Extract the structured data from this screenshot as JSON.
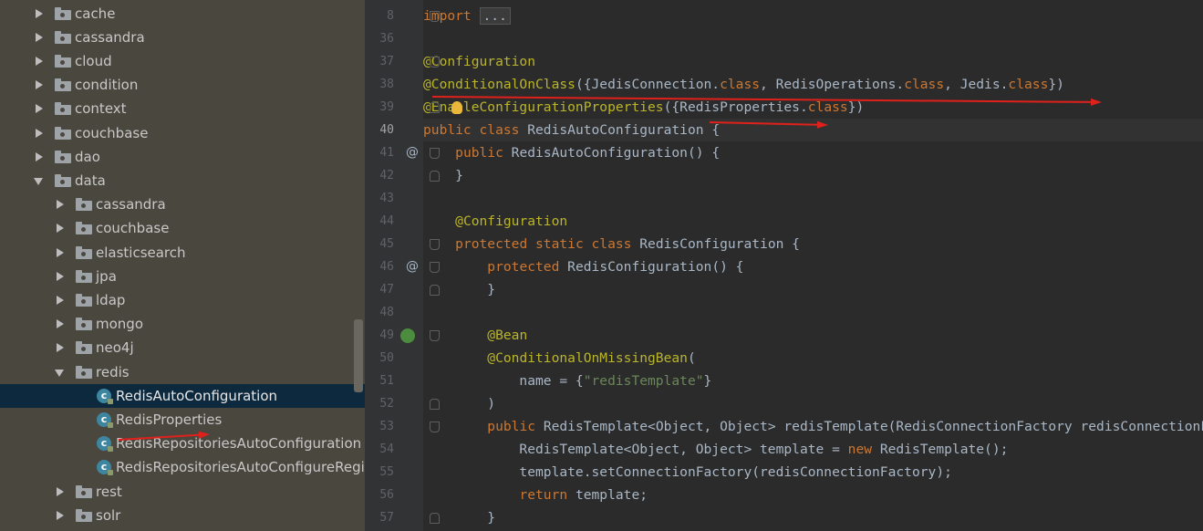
{
  "project_tree": {
    "rows": [
      {
        "label": "cache",
        "kind": "package",
        "state": "collapsed",
        "depth": 0
      },
      {
        "label": "cassandra",
        "kind": "package",
        "state": "collapsed",
        "depth": 0
      },
      {
        "label": "cloud",
        "kind": "package",
        "state": "collapsed",
        "depth": 0
      },
      {
        "label": "condition",
        "kind": "package",
        "state": "collapsed",
        "depth": 0
      },
      {
        "label": "context",
        "kind": "package",
        "state": "collapsed",
        "depth": 0
      },
      {
        "label": "couchbase",
        "kind": "package",
        "state": "collapsed",
        "depth": 0
      },
      {
        "label": "dao",
        "kind": "package",
        "state": "collapsed",
        "depth": 0
      },
      {
        "label": "data",
        "kind": "package",
        "state": "expanded",
        "depth": 0
      },
      {
        "label": "cassandra",
        "kind": "package",
        "state": "collapsed",
        "depth": 1
      },
      {
        "label": "couchbase",
        "kind": "package",
        "state": "collapsed",
        "depth": 1
      },
      {
        "label": "elasticsearch",
        "kind": "package",
        "state": "collapsed",
        "depth": 1
      },
      {
        "label": "jpa",
        "kind": "package",
        "state": "collapsed",
        "depth": 1
      },
      {
        "label": "ldap",
        "kind": "package",
        "state": "collapsed",
        "depth": 1
      },
      {
        "label": "mongo",
        "kind": "package",
        "state": "collapsed",
        "depth": 1
      },
      {
        "label": "neo4j",
        "kind": "package",
        "state": "collapsed",
        "depth": 1
      },
      {
        "label": "redis",
        "kind": "package",
        "state": "expanded",
        "depth": 1
      },
      {
        "label": "RedisAutoConfiguration",
        "kind": "class",
        "state": "leaf",
        "depth": 2,
        "selected": true
      },
      {
        "label": "RedisProperties",
        "kind": "class",
        "state": "leaf",
        "depth": 2
      },
      {
        "label": "RedisRepositoriesAutoConfiguration",
        "kind": "class",
        "state": "leaf",
        "depth": 2
      },
      {
        "label": "RedisRepositoriesAutoConfigureRegi",
        "kind": "class",
        "state": "leaf",
        "depth": 2
      },
      {
        "label": "rest",
        "kind": "package",
        "state": "collapsed",
        "depth": 1
      },
      {
        "label": "solr",
        "kind": "package",
        "state": "collapsed",
        "depth": 1
      }
    ]
  },
  "editor": {
    "current_line": 40,
    "lines": [
      {
        "num": "8",
        "fold": "down",
        "tokens": [
          [
            "kw",
            "import "
          ],
          [
            "fold",
            "..."
          ]
        ]
      },
      {
        "num": "36",
        "tokens": []
      },
      {
        "num": "37",
        "fold": "down",
        "tokens": [
          [
            "ann",
            "@Configuration"
          ]
        ]
      },
      {
        "num": "38",
        "tokens": [
          [
            "ann",
            "@ConditionalOnClass"
          ],
          [
            "plain",
            "({JedisConnection."
          ],
          [
            "kw",
            "class"
          ],
          [
            "plain",
            ", RedisOperations."
          ],
          [
            "kw",
            "class"
          ],
          [
            "plain",
            ", Jedis."
          ],
          [
            "kw",
            "class"
          ],
          [
            "plain",
            "})"
          ]
        ]
      },
      {
        "num": "39",
        "fold": "up",
        "tokens": [
          [
            "ann",
            "@EnableConfigurationProperties"
          ],
          [
            "plain",
            "({RedisProperties."
          ],
          [
            "kw",
            "class"
          ],
          [
            "plain",
            "})"
          ]
        ]
      },
      {
        "num": "40",
        "tokens": [
          [
            "kw",
            "public class "
          ],
          [
            "plain",
            "RedisAutoConfiguration {"
          ]
        ]
      },
      {
        "num": "41",
        "mark": "@",
        "fold": "down",
        "tokens": [
          [
            "plain",
            "    "
          ],
          [
            "kw",
            "public "
          ],
          [
            "plain",
            "RedisAutoConfiguration() {"
          ]
        ]
      },
      {
        "num": "42",
        "fold": "up",
        "tokens": [
          [
            "plain",
            "    }"
          ]
        ]
      },
      {
        "num": "43",
        "tokens": []
      },
      {
        "num": "44",
        "tokens": [
          [
            "plain",
            "    "
          ],
          [
            "ann",
            "@Configuration"
          ]
        ]
      },
      {
        "num": "45",
        "fold": "down",
        "tokens": [
          [
            "plain",
            "    "
          ],
          [
            "kw",
            "protected static class "
          ],
          [
            "plain",
            "RedisConfiguration {"
          ]
        ]
      },
      {
        "num": "46",
        "mark": "@",
        "fold": "down",
        "tokens": [
          [
            "plain",
            "        "
          ],
          [
            "kw",
            "protected "
          ],
          [
            "plain",
            "RedisConfiguration() {"
          ]
        ]
      },
      {
        "num": "47",
        "fold": "up",
        "tokens": [
          [
            "plain",
            "        }"
          ]
        ]
      },
      {
        "num": "48",
        "tokens": []
      },
      {
        "num": "49",
        "mark": "bean",
        "fold": "down",
        "tokens": [
          [
            "plain",
            "        "
          ],
          [
            "ann",
            "@Bean"
          ]
        ]
      },
      {
        "num": "50",
        "tokens": [
          [
            "plain",
            "        "
          ],
          [
            "ann",
            "@ConditionalOnMissingBean"
          ],
          [
            "plain",
            "("
          ]
        ]
      },
      {
        "num": "51",
        "tokens": [
          [
            "plain",
            "            name = {"
          ],
          [
            "str",
            "\"redisTemplate\""
          ],
          [
            "plain",
            "}"
          ]
        ]
      },
      {
        "num": "52",
        "fold": "up",
        "tokens": [
          [
            "plain",
            "        )"
          ]
        ]
      },
      {
        "num": "53",
        "fold": "down",
        "tokens": [
          [
            "plain",
            "        "
          ],
          [
            "kw",
            "public "
          ],
          [
            "plain",
            "RedisTemplate<Object, Object> redisTemplate(RedisConnectionFactory redisConnectionFactory)"
          ]
        ]
      },
      {
        "num": "54",
        "tokens": [
          [
            "plain",
            "            RedisTemplate<Object, Object> template = "
          ],
          [
            "kw",
            "new "
          ],
          [
            "plain",
            "RedisTemplate();"
          ]
        ]
      },
      {
        "num": "55",
        "tokens": [
          [
            "plain",
            "            template.setConnectionFactory(redisConnectionFactory);"
          ]
        ]
      },
      {
        "num": "56",
        "tokens": [
          [
            "plain",
            "            "
          ],
          [
            "kw",
            "return "
          ],
          [
            "plain",
            "template;"
          ]
        ]
      },
      {
        "num": "57",
        "fold": "up",
        "tokens": [
          [
            "plain",
            "        }"
          ]
        ]
      }
    ]
  },
  "annotations": {
    "arrow_color": "#e0211b",
    "arrows": [
      "line-38-underline",
      "line-39-underline",
      "redisproperties-underline"
    ]
  }
}
